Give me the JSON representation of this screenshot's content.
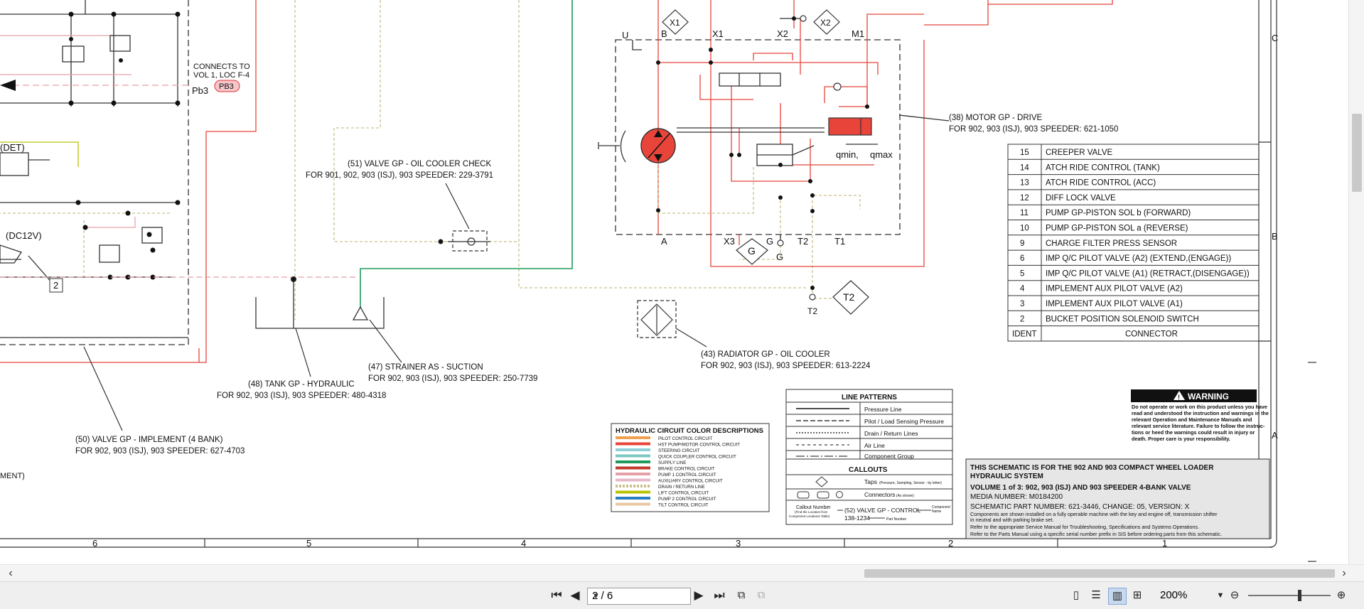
{
  "colors": {
    "pressure": "#e03333",
    "pilot": "#e7a0a8",
    "drain": "#c9c08a",
    "supply": "#2a9a6a",
    "pump": "#e8443a",
    "gray": "#555555"
  },
  "left_partial": {
    "connects": "CONNECTS TO",
    "vol": "VOL 1, LOC F-4",
    "pb3": "Pb3",
    "pb3_tag": "PB3",
    "det": "(DET)",
    "dc12v": "(DC12V)",
    "callout_2": "2",
    "ment": "MENT)"
  },
  "callouts": {
    "c51_title": "(51) VALVE GP - OIL COOLER CHECK",
    "c51_sub": "FOR 901, 902, 903 (ISJ), 903 SPEEDER: 229-3791",
    "c47_title": "(47) STRAINER AS - SUCTION",
    "c47_sub": "FOR 902, 903 (ISJ), 903 SPEEDER: 250-7739",
    "c48_title": "(48) TANK GP - HYDRAULIC",
    "c48_sub": "FOR 902, 903 (ISJ), 903 SPEEDER: 480-4318",
    "c50_title": "(50) VALVE GP - IMPLEMENT (4 BANK)",
    "c50_sub": "FOR 902, 903 (ISJ), 903 SPEEDER: 627-4703",
    "c43_title": "(43) RADIATOR GP - OIL COOLER",
    "c43_sub": "FOR 902, 903 (ISJ), 903 SPEEDER: 613-2224",
    "c38_title": "(38) MOTOR GP - DRIVE",
    "c38_sub": "FOR 902, 903 (ISJ), 903 SPEEDER: 621-1050"
  },
  "motor_ports": {
    "u": "U",
    "b": "B",
    "x1": "X1",
    "x2": "X2",
    "m1": "M1",
    "a": "A",
    "x3": "X3",
    "g": "G",
    "t2": "T2",
    "t1": "T1",
    "qmin": "qmin,",
    "qmax": "qmax"
  },
  "connector_table": {
    "rows": [
      {
        "ident": "15",
        "connector": "CREEPER VALVE"
      },
      {
        "ident": "14",
        "connector": "ATCH RIDE CONTROL (TANK)"
      },
      {
        "ident": "13",
        "connector": "ATCH RIDE CONTROL (ACC)"
      },
      {
        "ident": "12",
        "connector": "DIFF LOCK VALVE"
      },
      {
        "ident": "11",
        "connector": "PUMP GP-PISTON SOL b (FORWARD)"
      },
      {
        "ident": "10",
        "connector": "PUMP GP-PISTON SOL a (REVERSE)"
      },
      {
        "ident": "9",
        "connector": "CHARGE FILTER PRESS SENSOR"
      },
      {
        "ident": "6",
        "connector": "IMP Q/C PILOT VALVE (A2) (EXTEND,(ENGAGE))"
      },
      {
        "ident": "5",
        "connector": "IMP Q/C PILOT VALVE (A1) (RETRACT,(DISENGAGE))"
      },
      {
        "ident": "4",
        "connector": "IMPLEMENT AUX PILOT VALVE (A2)"
      },
      {
        "ident": "3",
        "connector": "IMPLEMENT AUX PILOT VALVE (A1)"
      },
      {
        "ident": "2",
        "connector": "BUCKET POSITION SOLENOID SWITCH"
      }
    ],
    "header_ident": "IDENT",
    "header_connector": "CONNECTOR"
  },
  "border": {
    "rows": [
      "C",
      "B",
      "A"
    ],
    "cols": [
      "6",
      "5",
      "4",
      "3",
      "2",
      "1"
    ]
  },
  "warning": {
    "title": "WARNING",
    "body": [
      "Do not operate or work on this product unless you have",
      "read and understood the instruction and warnings in the",
      "relevant Operation and Maintenance Manuals and",
      "relevant service literature. Failure to follow the instruc-",
      "tions or heed the warnings could result in injury or",
      "death. Proper care is your responsibility."
    ]
  },
  "color_legend": {
    "title": "HYDRAULIC CIRCUIT COLOR DESCRIPTIONS",
    "items": [
      {
        "label": "PILOT CONTROL CIRCUIT",
        "color": "#f0a050"
      },
      {
        "label": "HST PUMP/MOTOR CONTROL CIRCUIT",
        "color": "#e8443a"
      },
      {
        "label": "STEERING CIRCUIT",
        "color": "#8fd0d8"
      },
      {
        "label": "QUICK COUPLER CONTROL CIRCUIT",
        "color": "#7cc8c0"
      },
      {
        "label": "SUPPLY LINE",
        "color": "#1e9a5a"
      },
      {
        "label": "BRAKE CONTROL CIRCUIT",
        "color": "#c0392b"
      },
      {
        "label": "PUMP 1 CONTROL CIRCUIT",
        "color": "#e7a0a8"
      },
      {
        "label": "AUXILIARY CONTROL CIRCUIT",
        "color": "#e8b8c8"
      },
      {
        "label": "DRAIN / RETURN LINE",
        "color": "#c9c08a"
      },
      {
        "label": "LIFT CONTROL CIRCUIT",
        "color": "#b8c400"
      },
      {
        "label": "PUMP 2 CONTROL CIRCUIT",
        "color": "#2a7fc0"
      },
      {
        "label": "TILT CONTROL CIRCUIT",
        "color": "#e8c8a0"
      }
    ]
  },
  "line_patterns": {
    "title": "LINE PATTERNS",
    "items": [
      "Pressure Line",
      "Pilot / Load Sensing Pressure",
      "Drain / Return Lines",
      "Air Line",
      "Component Group"
    ],
    "callouts_title": "CALLOUTS",
    "taps": "Taps",
    "taps_note": "(Pressure, Sampling, Sensor - by letter)",
    "connectors": "Connectors",
    "connectors_note": "(As shown)",
    "callout_number": "Callout Number",
    "callout_note1": "(Find the Location from",
    "callout_note2": "Component Locations Table)",
    "example": "(52) VALVE GP - CONTROL",
    "example_pn": "138-1234",
    "component_name": "Component",
    "component_name2": "Name",
    "part_number": "Part Number"
  },
  "title_block": {
    "line1": "THIS SCHEMATIC IS FOR THE 902 AND 903 COMPACT WHEEL LOADER",
    "line2": "HYDRAULIC SYSTEM",
    "line3": "VOLUME 1 of 3: 902, 903 (ISJ) AND 903 SPEEDER 4-BANK VALVE",
    "line4": "MEDIA NUMBER: M0184200",
    "line5": "SCHEMATIC PART NUMBER: 621-3446, CHANGE: 05, VERSION: X",
    "line6": "Components are shown installed on a fully operable machine with the key and engine off, transmission shifter",
    "line7": "in neutral and with parking brake set.",
    "line8": "Refer to the appropriate Service Manual for Troubleshooting, Specifications and Systems Operations.",
    "line9": "Refer to the Parts Manual using a specific serial number prefix in SIS before ordering parts from this schematic."
  },
  "toolbar": {
    "page_value": "2 / 6",
    "zoom": "200%",
    "first": "first-page",
    "prev": "prev-page",
    "next": "next-page",
    "last": "last-page"
  }
}
